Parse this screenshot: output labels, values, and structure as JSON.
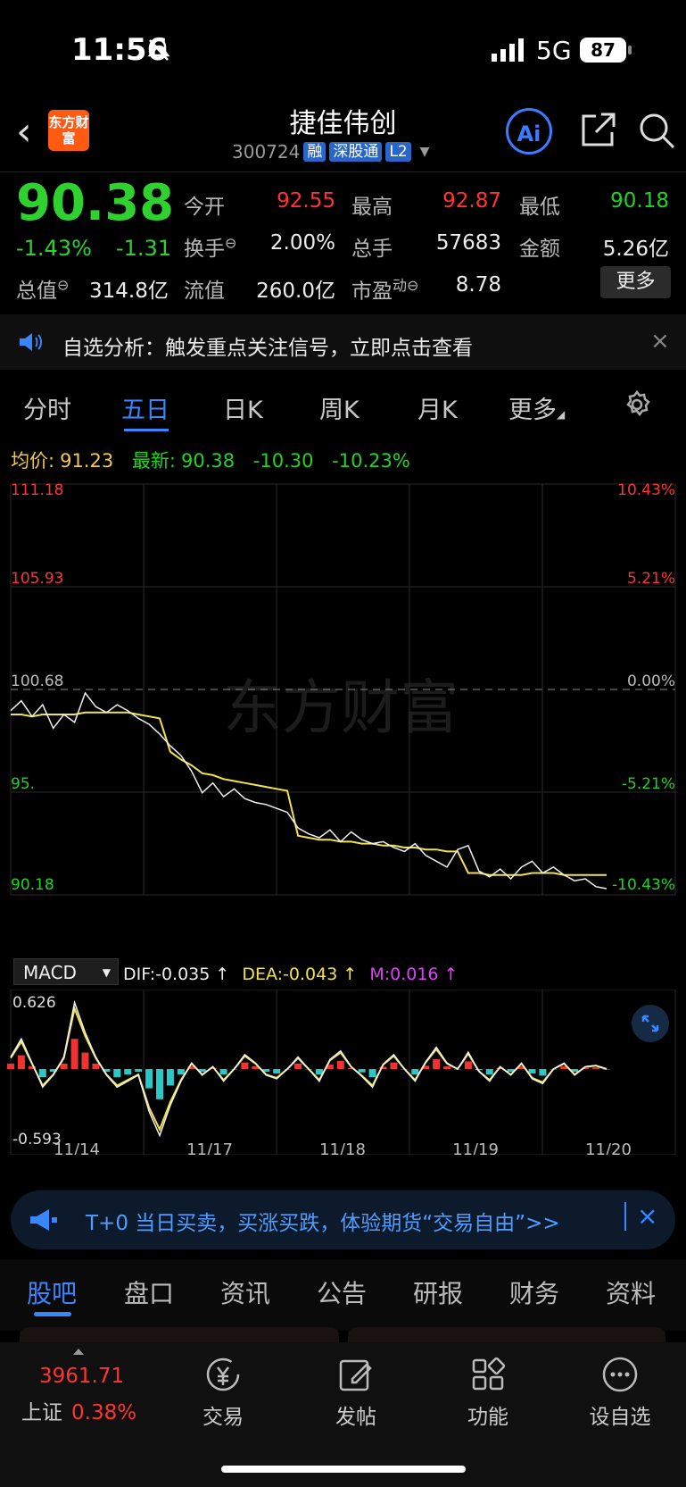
{
  "status": {
    "time": "11:56",
    "network": "5G",
    "battery": "87"
  },
  "header": {
    "logo_text": "东方财富",
    "stock_name": "捷佳伟创",
    "code": "300724",
    "tags": [
      "融",
      "深股通",
      "L2"
    ],
    "ai_label": "Ai"
  },
  "quote": {
    "price": "90.38",
    "change_pct": "-1.43%",
    "change": "-1.31",
    "fields": [
      {
        "label": "今开",
        "value": "92.55",
        "color": "#ff3333"
      },
      {
        "label": "最高",
        "value": "92.87",
        "color": "#ff3333"
      },
      {
        "label": "最低",
        "value": "90.18",
        "color": "#22d222"
      },
      {
        "label": "换手",
        "value": "2.00%",
        "color": "#eeeeee"
      },
      {
        "label": "总手",
        "value": "57683",
        "color": "#eeeeee"
      },
      {
        "label": "金额",
        "value": "5.26亿",
        "color": "#eeeeee"
      },
      {
        "label": "总值",
        "value": "314.8亿",
        "color": "#eeeeee"
      },
      {
        "label": "流值",
        "value": "260.0亿",
        "color": "#eeeeee"
      },
      {
        "label": "市盈",
        "value": "8.78",
        "color": "#eeeeee"
      }
    ],
    "pe_sup": "动",
    "more_label": "更多"
  },
  "notice": {
    "text": "自选分析：触发重点关注信号，立即点击查看",
    "close": "×"
  },
  "chart_tabs": {
    "items": [
      "分时",
      "五日",
      "日K",
      "周K",
      "月K",
      "更多"
    ],
    "active": "五日"
  },
  "info": {
    "avg_label": "均价:",
    "avg_value": "91.23",
    "latest_label": "最新:",
    "latest_value": "90.38",
    "chg": "-10.30",
    "chg_pct": "-10.23%"
  },
  "chart_data": {
    "type": "line",
    "title": "",
    "ylim": [
      90.18,
      111.18
    ],
    "y_ticks_left": [
      "111.18",
      "105.93",
      "100.68",
      "95.",
      "90.18"
    ],
    "y_ticks_right": [
      "10.43%",
      "5.21%",
      "0.00%",
      "-5.21%",
      "-10.43%"
    ],
    "x_labels": [
      "11/14",
      "11/17",
      "11/18",
      "11/19",
      "11/20"
    ],
    "prev_close": 100.68,
    "series": [
      {
        "name": "price",
        "values": [
          99.6,
          100.1,
          99.3,
          99.9,
          98.7,
          99.4,
          99.0,
          100.5,
          99.8,
          99.5,
          99.9,
          99.6,
          99.2,
          98.9,
          98.4,
          97.8,
          97.3,
          96.5,
          95.4,
          95.9,
          95.2,
          95.6,
          95.1,
          94.9,
          94.8,
          94.6,
          94.4,
          93.6,
          93.3,
          93.1,
          93.5,
          92.9,
          93.4,
          93.0,
          92.8,
          92.9,
          92.6,
          92.4,
          92.8,
          92.2,
          91.9,
          91.6,
          92.5,
          92.7,
          91.4,
          91.1,
          91.5,
          91.0,
          91.6,
          91.9,
          91.3,
          91.6,
          91.2,
          90.9,
          91.0,
          90.6,
          90.5
        ]
      },
      {
        "name": "avg",
        "values": [
          99.4,
          99.4,
          99.3,
          99.4,
          99.4,
          99.4,
          99.4,
          99.5,
          99.5,
          99.5,
          99.5,
          99.5,
          99.4,
          99.3,
          99.2,
          97.5,
          97.1,
          96.8,
          96.4,
          96.3,
          96.1,
          96.0,
          95.9,
          95.8,
          95.7,
          95.6,
          95.5,
          93.2,
          93.1,
          93.0,
          93.0,
          92.9,
          92.9,
          92.8,
          92.8,
          92.7,
          92.7,
          92.6,
          92.6,
          92.5,
          92.5,
          92.4,
          92.4,
          91.3,
          91.3,
          91.2,
          91.2,
          91.2,
          91.2,
          91.3,
          91.3,
          91.3,
          91.2,
          91.2,
          91.2,
          91.2,
          91.2
        ]
      }
    ],
    "macd": {
      "label": "MACD",
      "dif": "DIF:-0.035 ↑",
      "dea": "DEA:-0.043 ↑",
      "m": "M:0.016 ↑",
      "max": "0.626",
      "min": "-0.593",
      "values": [
        0.1,
        0.25,
        0.05,
        -0.15,
        -0.05,
        0.1,
        0.55,
        0.3,
        0.1,
        -0.05,
        -0.15,
        -0.1,
        -0.05,
        -0.35,
        -0.55,
        -0.3,
        -0.1,
        0.05,
        -0.05,
        0.02,
        -0.1,
        0.0,
        0.12,
        0.05,
        -0.05,
        -0.08,
        0.0,
        0.1,
        0.0,
        -0.1,
        0.08,
        0.15,
        0.02,
        -0.06,
        -0.15,
        0.04,
        0.12,
        0.0,
        -0.1,
        0.06,
        0.18,
        0.05,
        0.0,
        0.14,
        -0.02,
        -0.1,
        0.02,
        -0.05,
        0.05,
        -0.08,
        -0.12,
        0.0,
        0.05,
        -0.05,
        0.02,
        0.03,
        0.0
      ]
    }
  },
  "ad": {
    "text": "T+0 当日买卖，买涨买跌，体验期货“交易自由”>>",
    "close": "×"
  },
  "bottom_tabs": {
    "items": [
      "股吧",
      "盘口",
      "资讯",
      "公告",
      "研报",
      "财务",
      "资料"
    ],
    "active": "股吧"
  },
  "footer": {
    "index_value": "3961.71",
    "index_name": "上证",
    "index_pct": "0.38%",
    "items": [
      {
        "label": "交易",
        "icon": "yen-exchange-icon"
      },
      {
        "label": "发帖",
        "icon": "edit-icon"
      },
      {
        "label": "功能",
        "icon": "grid-icon"
      },
      {
        "label": "设自选",
        "icon": "more-dots-icon"
      }
    ]
  }
}
